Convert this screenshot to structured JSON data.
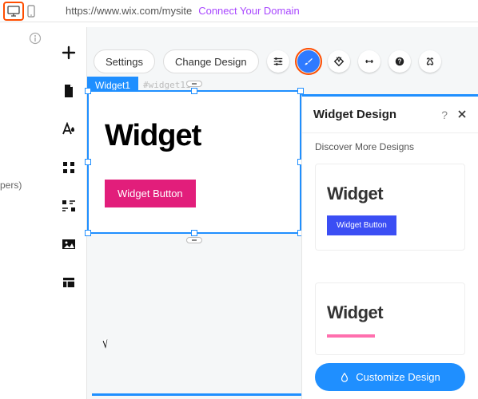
{
  "topbar": {
    "url": "https://www.wix.com/mysite",
    "connect_label": "Connect Your Domain"
  },
  "left_sidebar_truncated": "pers)",
  "action_bar": {
    "settings_label": "Settings",
    "change_design_label": "Change Design"
  },
  "widget": {
    "tab_label": "Widget1",
    "id_label": "#widget11",
    "title": "Widget",
    "button_label": "Widget Button"
  },
  "panel": {
    "title": "Widget Design",
    "subtitle": "Discover More Designs",
    "customize_label": "Customize Design",
    "designs": [
      {
        "title": "Widget",
        "button_label": "Widget Button",
        "button_color": "#3b4ef4"
      },
      {
        "title": "Widget",
        "button_label": "",
        "button_color": "#ff6fae"
      }
    ]
  }
}
